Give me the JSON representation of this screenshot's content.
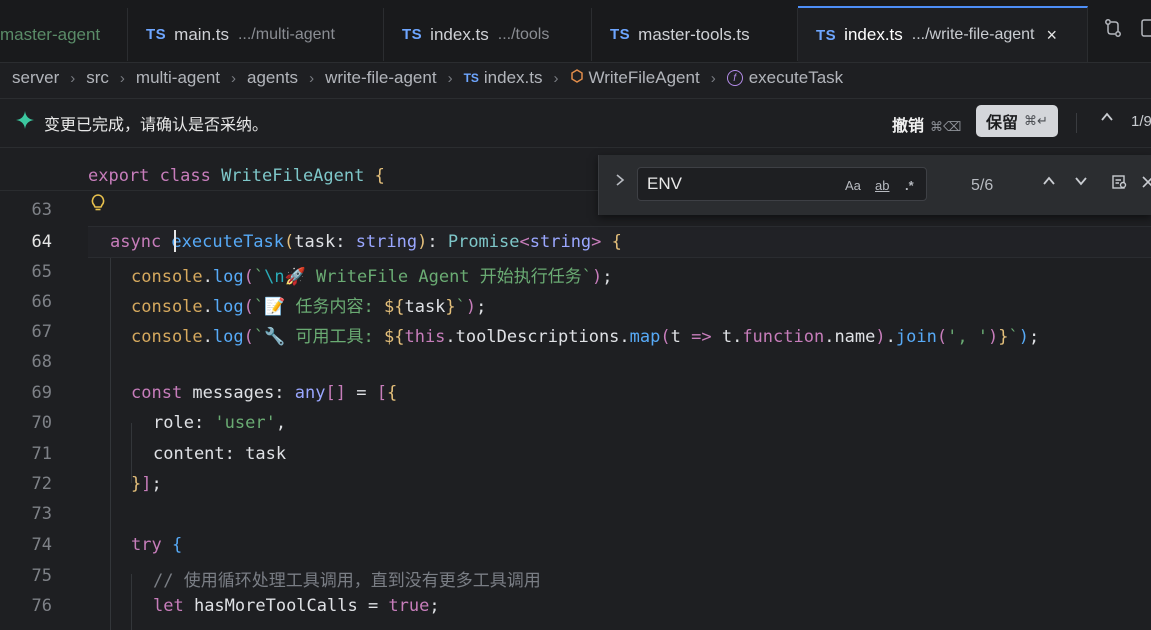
{
  "tabs": [
    {
      "name": "master-agent",
      "path": ""
    },
    {
      "icon": "TS",
      "name": "main.ts",
      "path": ".../multi-agent"
    },
    {
      "icon": "TS",
      "name": "index.ts",
      "path": ".../tools"
    },
    {
      "icon": "TS",
      "name": "master-tools.ts",
      "path": ""
    },
    {
      "icon": "TS",
      "name": "index.ts",
      "path": ".../write-file-agent",
      "close": "×"
    }
  ],
  "breadcrumb": {
    "items": [
      "server",
      "src",
      "multi-agent",
      "agents",
      "write-file-agent"
    ],
    "file_icon": "TS",
    "file": "index.ts",
    "class": "WriteFileAgent",
    "method": "executeTask",
    "separator": "›"
  },
  "notification": {
    "message": "变更已完成，请确认是否采纳。",
    "undo_label": "撤销",
    "undo_shortcut": "⌘⌫",
    "keep_label": "保留",
    "keep_shortcut": "⌘↵",
    "counter": "1/9"
  },
  "find": {
    "value": "ENV",
    "match_case": "Aa",
    "whole_word": "ab",
    "regex": ".*",
    "count": "5/6"
  },
  "editor": {
    "sticky_header": "export class WriteFileAgent {",
    "current_line": 64,
    "line_numbers": [
      "63",
      "64",
      "65",
      "66",
      "67",
      "68",
      "69",
      "70",
      "71",
      "72",
      "73",
      "74",
      "75",
      "76"
    ],
    "lines": [
      "",
      "  async executeTask(task: string): Promise<string> {",
      "    console.log(`\\n🚀 WriteFile Agent 开始执行任务`);",
      "    console.log(`📝 任务内容: ${task}`);",
      "    console.log(`🔧 可用工具: ${this.toolDescriptions.map(t => t.function.name).join(', ')}`);",
      "",
      "    const messages: any[] = [{",
      "      role: 'user',",
      "      content: task",
      "    }];",
      "",
      "    try {",
      "      // 使用循环处理工具调用，直到没有更多工具调用",
      "      let hasMoreToolCalls = true;"
    ]
  },
  "icons": {
    "spark": "sparkle-icon",
    "lightbulb": "lightbulb-icon",
    "chevron_up": "chevron-up-icon",
    "chevron_down": "chevron-down-icon"
  },
  "colors": {
    "accent": "#4d8ef7",
    "keyword": "#c77dbb",
    "string": "#6aab73",
    "function": "#57aaf7"
  }
}
